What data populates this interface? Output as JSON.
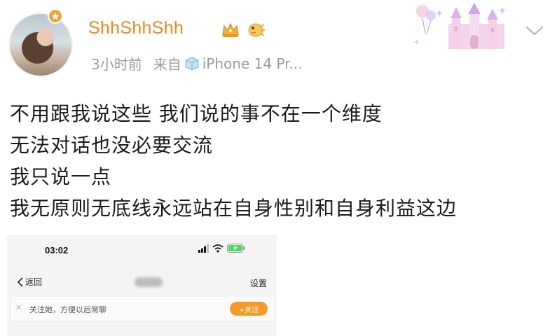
{
  "post": {
    "username": "ShhShhShh",
    "time": "3小时前",
    "source_prefix": "来自",
    "source_device": "iPhone 14 Pr...",
    "lines": [
      "不用跟我说这些 我们说的事不在一个维度",
      "无法对话也没必要交流",
      "我只说一点",
      "我无原则无底线永远站在自身性别和自身利益这边"
    ]
  },
  "embedded_screenshot": {
    "time": "03:02",
    "back_label": "返回",
    "settings_label": "设置",
    "follow_tip": "关注她，方便以后常聊",
    "follow_button": "+关注"
  },
  "colors": {
    "username": "#e58a1f",
    "meta": "#9a9a9a",
    "follow_button": "#f39a2b"
  },
  "icons": [
    "vip-badge-icon",
    "crown-badge-icon",
    "pufferfish-badge-icon",
    "ice-cube-icon",
    "castle-decoration",
    "chevron-down-icon",
    "signal-icon",
    "wifi-icon",
    "battery-icon",
    "back-chevron-icon",
    "close-icon"
  ]
}
